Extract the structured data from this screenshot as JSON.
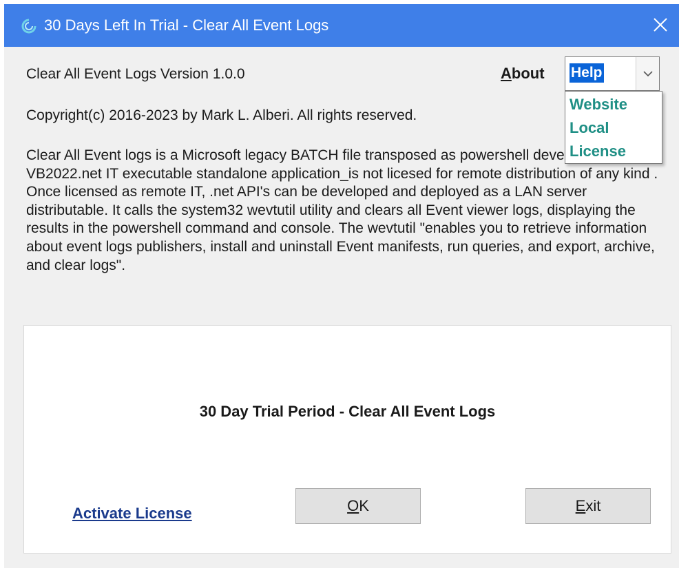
{
  "window": {
    "title": "30 Days Left In Trial - Clear All Event Logs",
    "title_bar_color": "#3f7fe8"
  },
  "header": {
    "version_text": "Clear All Event Logs Version 1.0.0",
    "about_label_first": "A",
    "about_label_rest": "bout"
  },
  "help_combo": {
    "selected": "Help",
    "options": [
      "Website",
      "Local",
      "License"
    ],
    "option_color": "#1f8f85"
  },
  "copyright": "Copyright(c) 2016-2023 by Mark L. Alberi. All rights reserved.",
  "description": "Clear All Event logs is a Microsoft legacy BATCH file transposed as powershell developed into a full VB2022.net IT executable standalone application_is not licesed for remote distribution of any kind . Once licensed as remote IT, .net API's can be developed and deployed as a LAN server distributable. It calls the system32 wevtutil utility and clears all Event viewer logs, displaying the results in the powershell command and console. The wevtutil \"enables you to retrieve information about event logs publishers, install and uninstall Event manifests, run queries, and export, archive, and clear logs\".",
  "panel": {
    "heading": "30 Day Trial Period - Clear All Event Logs",
    "activate_link": "Activate License",
    "ok_first": "O",
    "ok_rest": "K",
    "exit_first": "E",
    "exit_rest": "xit"
  }
}
